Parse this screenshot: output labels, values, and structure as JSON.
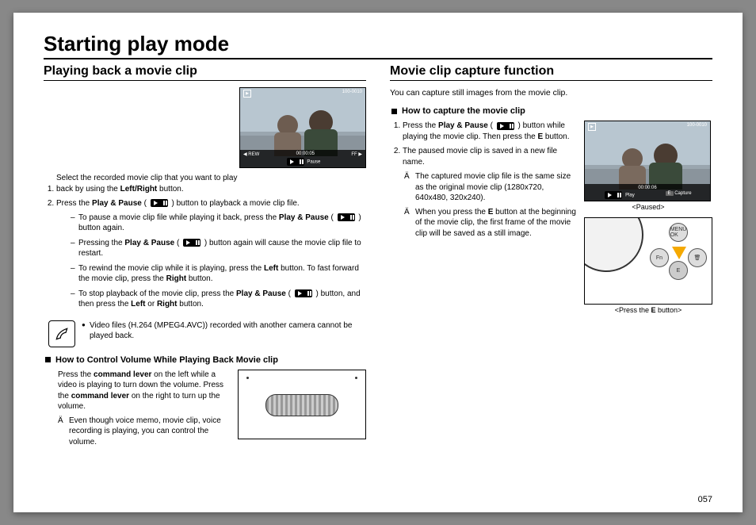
{
  "page": {
    "title": "Starting play mode",
    "number": "057"
  },
  "left": {
    "heading": "Playing back a movie clip",
    "step1": "Select the recorded movie clip that you want to play back by using the ",
    "step1_bold": "Left/Right",
    "step1_tail": " button.",
    "step2a": "Press the ",
    "step2b": "Play & Pause",
    "step2c": " button to playback a movie clip file.",
    "bullet1a": "To pause a movie clip file while playing it back, press the ",
    "bullet1b": "Play & Pause",
    "bullet1c": " button again.",
    "bullet2a": "Pressing the ",
    "bullet2b": "Play & Pause",
    "bullet2c": " button again will cause the movie clip file to restart.",
    "bullet3a": "To rewind the movie clip while it is playing, press the ",
    "bullet3b": "Left",
    "bullet3c": " button. To fast forward the movie clip, press the ",
    "bullet3d": "Right",
    "bullet3e": " button.",
    "bullet4a": "To stop playback of the movie clip, press the ",
    "bullet4b": "Play & Pause",
    "bullet4c": " button, and then press the ",
    "bullet4d": "Left",
    "bullet4e": " or ",
    "bullet4f": "Right",
    "bullet4g": " button.",
    "note": "Video files (H.264 (MPEG4.AVC)) recorded with another camera cannot be played back.",
    "volume_heading": "How to Control Volume While Playing Back Movie clip",
    "vol1a": "Press the ",
    "vol1b": "command lever",
    "vol1c": " on the left while a video is playing to turn down the volume. Press the ",
    "vol1d": "command lever",
    "vol1e": " on the right to turn up the volume.",
    "vol_star": "Even though voice memo, movie clip, voice recording is playing, you can  control the volume.",
    "screen_top_counter": "100-0010",
    "screen_rew": "◀ REW",
    "screen_time": "00:00:05",
    "screen_ff": "FF ▶",
    "screen_pause": "Pause"
  },
  "right": {
    "heading": "Movie clip capture function",
    "intro": "You can capture still images from the movie clip.",
    "sub_heading": "How to capture the movie clip",
    "step1a": "Press the ",
    "step1b": "Play & Pause",
    "step1c": " button while playing the movie clip. Then press the ",
    "step1d": "E",
    "step1e": " button.",
    "step2": "The paused movie clip is saved in a new file name.",
    "star1": "The captured movie clip file is the same size as the original movie clip (1280x720, 640x480, 320x240).",
    "star2a": "When you press the ",
    "star2b": "E",
    "star2c": " button at the beginning of the movie clip, the first frame of the movie clip will be saved as a still image.",
    "caption1": "<Paused>",
    "caption2": "<Press the E button>",
    "screen_top_counter": "100-0010",
    "screen_time": "00:00:06",
    "screen_play": "Play",
    "screen_capture": "Capture",
    "screen_capture_key": "E"
  }
}
